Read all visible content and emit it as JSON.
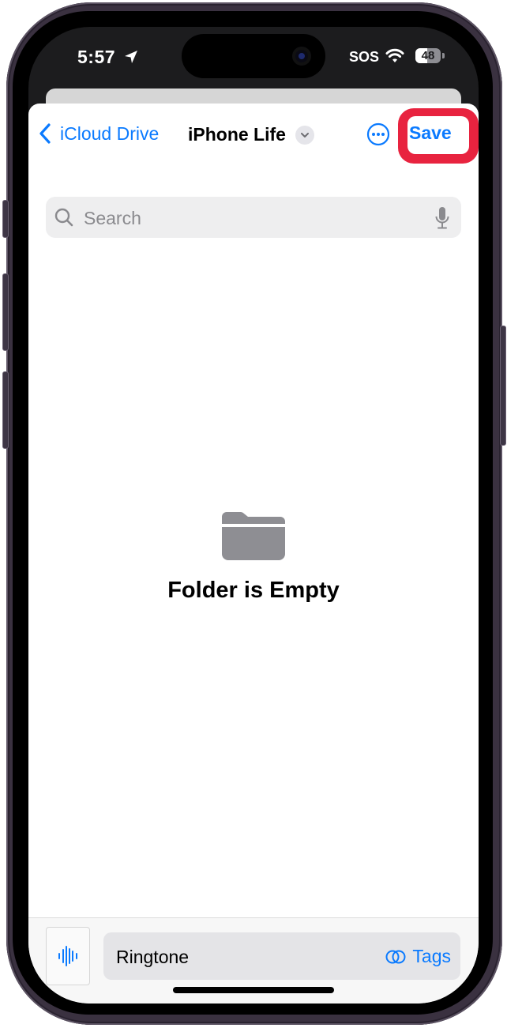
{
  "status_bar": {
    "time": "5:57",
    "location_icon": "location-arrow-icon",
    "carrier_status": "SOS",
    "wifi_icon": "wifi-icon",
    "battery_percent": 48
  },
  "nav": {
    "back_label": "iCloud Drive",
    "back_icon": "chevron-left-icon",
    "title": "iPhone Life",
    "title_menu_icon": "chevron-down-icon",
    "more_icon": "ellipsis-circle-icon",
    "save_label": "Save",
    "highlight_color": "#e8233f"
  },
  "search": {
    "placeholder": "Search",
    "value": "",
    "search_icon": "magnifying-glass-icon",
    "mic_icon": "microphone-icon"
  },
  "content": {
    "empty_icon": "folder-icon",
    "empty_label": "Folder is Empty"
  },
  "bottom_bar": {
    "file_icon": "audio-waveform-icon",
    "filename": "Ringtone",
    "tags_label": "Tags",
    "tags_icon": "tags-circles-icon"
  },
  "colors": {
    "accent": "#0a7aff",
    "folder_gray": "#8e8e93"
  }
}
